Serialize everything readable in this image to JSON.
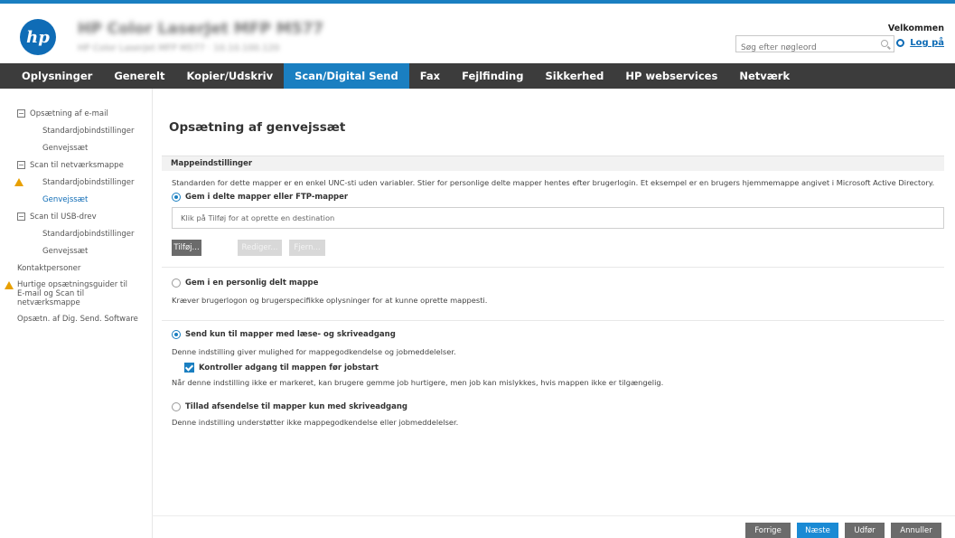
{
  "header": {
    "logo_text": "hp",
    "product_title": "HP Color LaserJet MFP M577",
    "product_subtitle": "HP Color LaserJet MFP M577 · 10.10.100.120",
    "search_placeholder": "Søg efter nøgleord",
    "welcome": "Velkommen",
    "logout": "Log på"
  },
  "nav": {
    "items": [
      "Oplysninger",
      "Generelt",
      "Kopier/Udskriv",
      "Scan/Digital Send",
      "Fax",
      "Fejlfinding",
      "Sikkerhed",
      "HP webservices",
      "Netværk"
    ],
    "active": "Scan/Digital Send"
  },
  "sidebar": {
    "email_setup": "Opsætning af e-mail",
    "email_defaults": "Standardjobindstillinger",
    "email_quicksets": "Genvejssæt",
    "scan_folder": "Scan til netværksmappe",
    "folder_defaults": "Standardjobindstillinger",
    "folder_quicksets": "Genvejssæt",
    "scan_usb": "Scan til USB-drev",
    "usb_defaults": "Standardjobindstillinger",
    "usb_quicksets": "Genvejssæt",
    "contacts": "Kontaktpersoner",
    "quick_setup_line1": "Hurtige opsætningsguider til",
    "quick_setup_line2": "E-mail og Scan til",
    "quick_setup_line3": "netværksmappe",
    "dss_setup": "Opsætn. af Dig. Send. Software"
  },
  "main": {
    "title": "Opsætning af genvejssæt",
    "section": "Mappeindstillinger",
    "section_desc": "Standarden for dette mapper er en enkel UNC-sti uden variabler. Stier for personlige delte mapper hentes efter brugerlogin. Et eksempel er en brugers hjemmemappe angivet i Microsoft Active Directory.",
    "radio_shared": "Gem i delte mapper eller FTP-mapper",
    "dest_placeholder": "Klik på Tilføj for at oprette en destination",
    "btn_add": "Tilføj...",
    "btn_edit": "Rediger...",
    "btn_remove": "Fjern...",
    "radio_personal": "Gem i en personlig delt mappe",
    "personal_desc": "Kræver brugerlogon og brugerspecifikke oplysninger for at kunne oprette mappesti.",
    "radio_rw": "Send kun til mapper med læse- og skriveadgang",
    "rw_desc": "Denne indstilling giver mulighed for mappegodkendelse og jobmeddelelser.",
    "checkbox_verify": "Kontroller adgang til mappen før jobstart",
    "verify_desc": "Når denne indstilling ikke er markeret, kan brugere gemme job hurtigere, men job kan mislykkes, hvis mappen ikke er tilgængelig.",
    "radio_write": "Tillad afsendelse til mapper kun med skriveadgang",
    "write_desc": "Denne indstilling understøtter ikke mappegodkendelse eller jobmeddelelser."
  },
  "footer": {
    "prev": "Forrige",
    "next": "Næste",
    "execute": "Udfør",
    "cancel": "Annuller"
  },
  "colors": {
    "accent": "#1a7fc1",
    "nav_bg": "#3c3c3c",
    "warning": "#e8a000"
  }
}
